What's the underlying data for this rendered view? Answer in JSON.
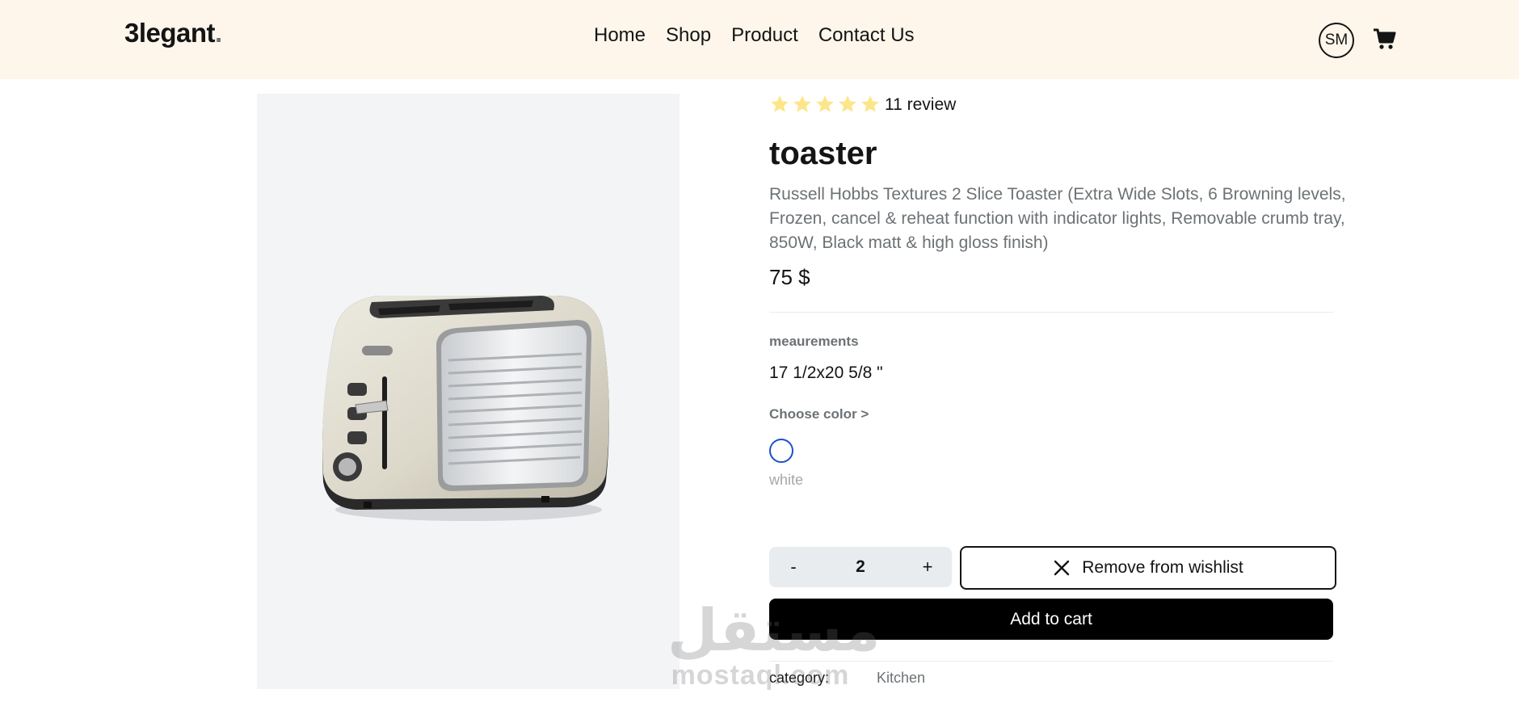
{
  "header": {
    "logo": "3legant",
    "logo_dot": ".",
    "nav": [
      "Home",
      "Shop",
      "Product",
      "Contact Us"
    ],
    "avatar_initials": "SM",
    "cart_icon": "shopping-cart-icon"
  },
  "product": {
    "rating": 5,
    "reviews_text": "11 review",
    "title": "toaster",
    "description": "Russell Hobbs Textures 2 Slice Toaster (Extra Wide Slots, 6 Browning levels, Frozen, cancel & reheat function with indicator lights, Removable crumb tray, 850W, Black matt & high gloss finish)",
    "price": "75 $",
    "measurements_label": "meaurements",
    "measurements_value": "17 1/2x20 5/8 \"",
    "choose_color_label": "Choose color >",
    "color_name": "white",
    "quantity": {
      "minus": "-",
      "value": "2",
      "plus": "+"
    },
    "wishlist_label": "Remove from wishlist",
    "add_to_cart_label": "Add to cart",
    "category_label": "category:",
    "category_value": "Kitchen"
  },
  "watermark": {
    "arabic": "مستقل",
    "latin": "mostaql.com"
  },
  "colors": {
    "header_bg": "#fef6eb",
    "star": "#fde68a",
    "swatch_border": "#1d4fd1",
    "button_bg": "#000000",
    "muted_text": "#6c7275"
  }
}
